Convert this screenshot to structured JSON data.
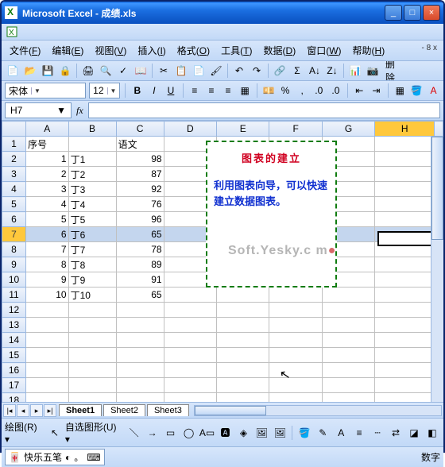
{
  "window": {
    "title": "Microsoft Excel - 成绩.xls"
  },
  "menus": [
    {
      "label": "文件",
      "hot": "F"
    },
    {
      "label": "编辑",
      "hot": "E"
    },
    {
      "label": "视图",
      "hot": "V"
    },
    {
      "label": "插入",
      "hot": "I"
    },
    {
      "label": "格式",
      "hot": "O"
    },
    {
      "label": "工具",
      "hot": "T"
    },
    {
      "label": "数据",
      "hot": "D"
    },
    {
      "label": "窗口",
      "hot": "W"
    },
    {
      "label": "帮助",
      "hot": "H"
    }
  ],
  "help_placeholder": "- 8 x",
  "font": {
    "name": "宋体",
    "size": "12"
  },
  "namebox": "H7",
  "columns": [
    "A",
    "B",
    "C",
    "D",
    "E",
    "F",
    "G",
    "H"
  ],
  "headers": {
    "A": "序号",
    "C": "语文"
  },
  "rows": [
    {
      "n": 1,
      "A": "1",
      "B": "丁1",
      "C": "98"
    },
    {
      "n": 2,
      "A": "2",
      "B": "丁2",
      "C": "87"
    },
    {
      "n": 3,
      "A": "3",
      "B": "丁3",
      "C": "92"
    },
    {
      "n": 4,
      "A": "4",
      "B": "丁4",
      "C": "76"
    },
    {
      "n": 5,
      "A": "5",
      "B": "丁5",
      "C": "96"
    },
    {
      "n": 6,
      "A": "6",
      "B": "丁6",
      "C": "65"
    },
    {
      "n": 7,
      "A": "7",
      "B": "丁7",
      "C": "78"
    },
    {
      "n": 8,
      "A": "8",
      "B": "丁8",
      "C": "89"
    },
    {
      "n": 9,
      "A": "9",
      "B": "丁9",
      "C": "91"
    },
    {
      "n": 10,
      "A": "10",
      "B": "丁10",
      "C": "65"
    }
  ],
  "selected_row": 7,
  "tooltip": {
    "title": "图表的建立",
    "body": "利用图表向导，可以快速建立数据图表。"
  },
  "watermark": "Soft.Yesky.c   m",
  "sheets": [
    "Sheet1",
    "Sheet2",
    "Sheet3"
  ],
  "active_sheet": 0,
  "draw_label": "绘图(R)",
  "autoshape_label": "自选图形(U)",
  "ime": {
    "name": "快乐五笔"
  },
  "status": {
    "right": "数字"
  },
  "delete_label": "删除"
}
